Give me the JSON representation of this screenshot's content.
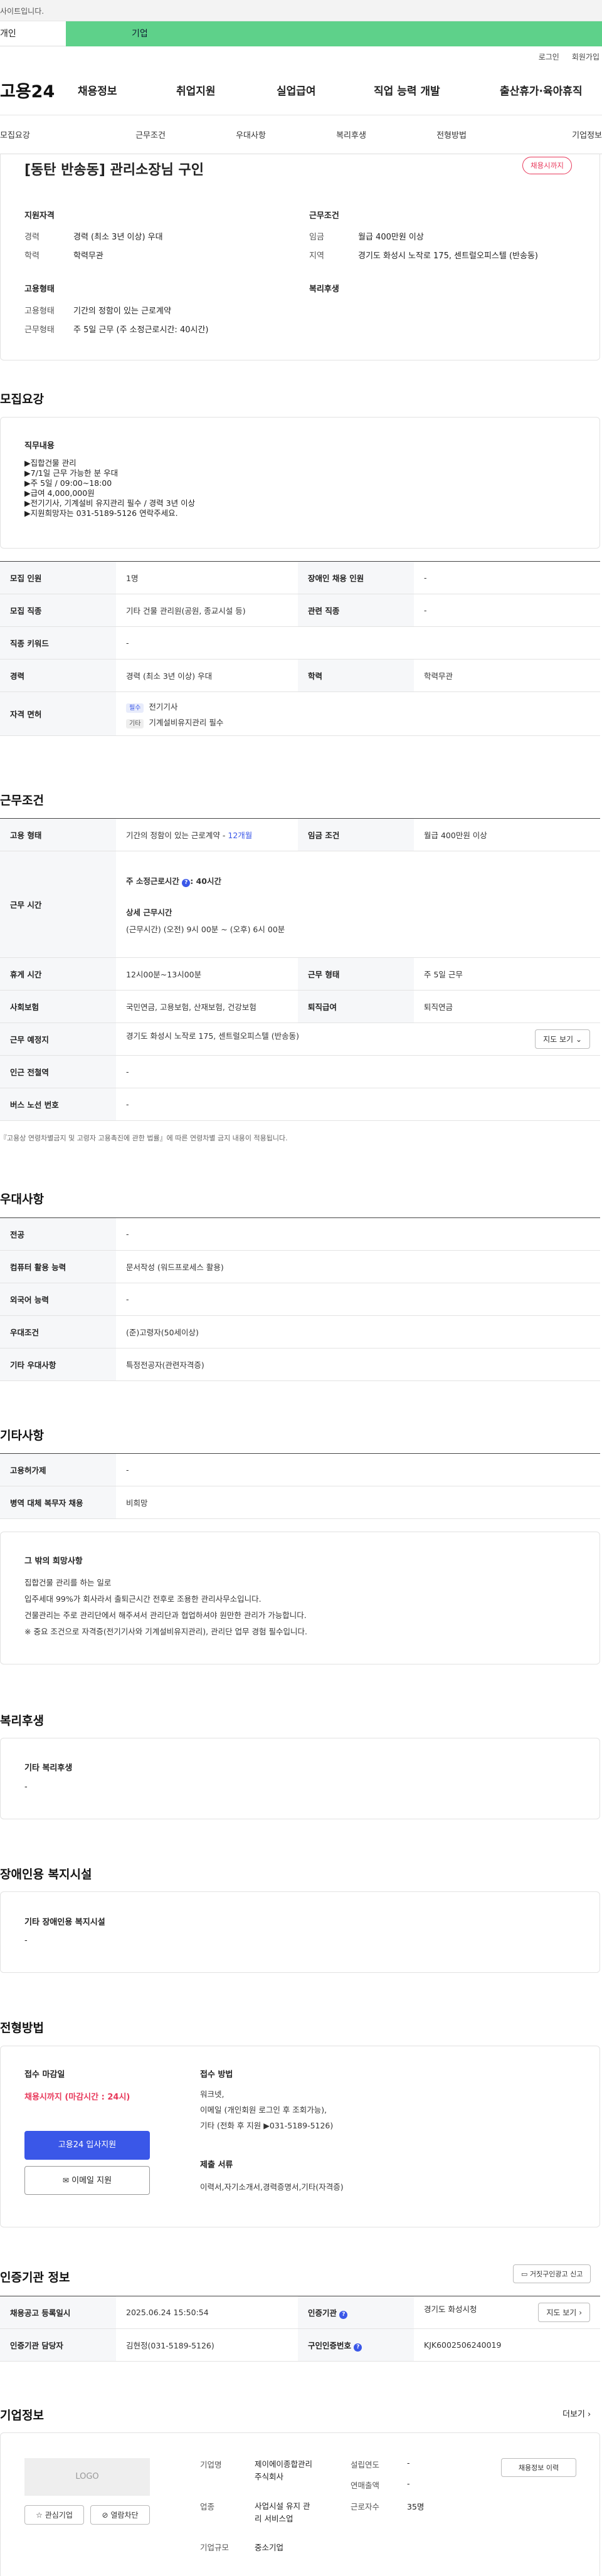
{
  "top_notice": "사이트입니다.",
  "user_tabs": {
    "personal": "개인",
    "corporate": "기업"
  },
  "util": {
    "login": "로그인",
    "signup": "회원가입"
  },
  "logo": "고용24",
  "gnb": [
    "채용정보",
    "취업지원",
    "실업급여",
    "직업 능력 개발",
    "출산휴가·육아휴직"
  ],
  "subnav": [
    "모집요강",
    "근무조건",
    "우대사항",
    "복리후생",
    "전형방법",
    "기업정보"
  ],
  "header": {
    "title": "[동탄 반송동] 관리소장님 구인",
    "badge": "채용시까지",
    "apply_label": "지원자격",
    "work_label": "근무조건",
    "career_k": "경력",
    "career_v": "경력 (최소 3년 이상) 우대",
    "edu_k": "학력",
    "edu_v": "학력무관",
    "wage_k": "임금",
    "wage_v": "월급 400만원 이상",
    "region_k": "지역",
    "region_v": "경기도 화성시 노작로 175, 센트럴오피스텔 (반송동)",
    "emp_label": "고용형태",
    "welfare_label": "복리후생",
    "emptype_k": "고용형태",
    "emptype_v": "기간의 정함이 있는 근로계약",
    "workform_k": "근무형태",
    "workform_v": "주 5일 근무 (주 소정근로시간: 40시간)"
  },
  "recruit": {
    "title": "모집요강",
    "duty_label": "직무내용",
    "duty_lines": [
      "▶집합건물 관리",
      "▶7/1일 근무 가능한 분 우대",
      "▶주 5일 / 09:00~18:00",
      "▶급여 4,000,000원",
      "▶전기기사, 기계설비 유지관리 필수 / 경력 3년 이상",
      "▶지원희망자는 031-5189-5126 연락주세요."
    ],
    "rows": {
      "count_k": "모집 인원",
      "count_v": "1명",
      "disabled_k": "장애인 채용 인원",
      "disabled_v": "-",
      "job_k": "모집 직종",
      "job_v": "기타 건물 관리원(공원, 종교시설 등)",
      "related_k": "관련 직종",
      "related_v": "-",
      "keyword_k": "직종 키워드",
      "keyword_v": "-",
      "career_k": "경력",
      "career_v": "경력 (최소 3년 이상) 우대",
      "edu_k": "학력",
      "edu_v": "학력무관",
      "license_k": "자격 면허",
      "license1_tag": "필수",
      "license1": "전기기사",
      "license2_tag": "기타",
      "license2": "기계설비유지관리 필수"
    }
  },
  "conditions": {
    "title": "근무조건",
    "emptype_k": "고용 형태",
    "emptype_v": "기간의 정함이 있는 근로계약 - ",
    "emptype_months": "12개월",
    "wage_k": "임금 조건",
    "wage_v": "월급 400만원 이상",
    "hours_k": "근무 시간",
    "hours_weekly": "주 소정근로시간 ",
    "hours_weekly_v": ": 40시간",
    "hours_detail_label": "상세 근무시간",
    "hours_detail": "(근무시간) (오전) 9시 00분 ~ (오후) 6시 00분",
    "break_k": "휴게 시간",
    "break_v": "12시00분~13시00분",
    "workform_k": "근무 형태",
    "workform_v": "주 5일 근무",
    "insurance_k": "사회보험",
    "insurance_v": "국민연금, 고용보험, 산재보험, 건강보험",
    "severance_k": "퇴직급여",
    "severance_v": "퇴직연금",
    "place_k": "근무 예정지",
    "place_v": "경기도 화성시 노작로 175, 센트럴오피스텔 (반송동)",
    "map_btn": "지도 보기",
    "subway_k": "인근 전철역",
    "subway_v": "-",
    "bus_k": "버스 노선 번호",
    "bus_v": "-",
    "note": "『고용상 연령차별금지 및 고령자 고용촉진에 관한 법률』에 따른 연령차별 금지 내용이 적용됩니다."
  },
  "preference": {
    "title": "우대사항",
    "major_k": "전공",
    "major_v": "-",
    "computer_k": "컴퓨터 활용 능력",
    "computer_v": "문서작성 (워드프로세스 활용)",
    "lang_k": "외국어 능력",
    "lang_v": "-",
    "cond_k": "우대조건",
    "cond_v": "(준)고령자(50세이상)",
    "etc_k": "기타 우대사항",
    "etc_v": "특정전공자(관련자격증)"
  },
  "other": {
    "title": "기타사항",
    "promo_k": "고용허가제",
    "promo_v": "-",
    "military_k": "병역 대체 복무자 채용",
    "military_v": "비희망",
    "wish_title": "그 밖의 희망사항",
    "wish_lines": [
      "집합건물 관리를 하는 일로",
      "입주세대 99%가 회사라서 출퇴근시간 전후로 조용한 관리사무소입니다.",
      "건물관리는 주로 관리단에서 해주셔서 관리단과 협업하셔야 원만한 관리가 가능합니다.",
      "※ 중요 조건으로 자격증(전기기사와 기계설비유지관리), 관리단 업무 경험 필수입니다."
    ]
  },
  "welfare": {
    "title": "복리후생",
    "box_title": "기타 복리후생",
    "box_value": "-"
  },
  "disabled": {
    "title": "장애인용 복지시설",
    "box_title": "기타 장애인용 복지시설",
    "box_value": "-"
  },
  "selection": {
    "title": "전형방법",
    "deadline_label": "접수 마감일",
    "deadline_value": "채용시까지 (마감시간 : 24시)",
    "apply_btn": "고용24 입사지원",
    "email_btn": "이메일 지원",
    "method_label": "접수 방법",
    "method_lines": [
      "워크넷,",
      "이메일 (개인회원 로그인 후 조회가능),",
      "기타 (전화 후 지원 ▶031-5189-5126)"
    ],
    "docs_label": "제출 서류",
    "docs_value": "이력서,자기소개서,경력증명서,기타(자격증)"
  },
  "auth": {
    "title": "인증기관 정보",
    "report_btn": "거짓구인광고 신고",
    "reg_k": "채용공고 등록일시",
    "reg_v": "2025.06.24 15:50:54",
    "org_k": "인증기관",
    "org_v": "경기도 화성시청",
    "map_btn": "지도 보기",
    "mgr_k": "인증기관 담당자",
    "mgr_v": "김현정(031-5189-5126)",
    "num_k": "구인인증번호",
    "num_v": "KJK6002506240019"
  },
  "company": {
    "title": "기업정보",
    "more": "더보기",
    "logo": "LOGO",
    "interest_btn": "관심기업",
    "block_btn": "열람차단",
    "name_k": "기업명",
    "name_v1": "제이에이종합관리",
    "name_v2": "주식회사",
    "biz_k": "업종",
    "biz_v1": "사업시설 유지 관",
    "biz_v2": "리 서비스업",
    "size_k": "기업규모",
    "size_v": "중소기업",
    "found_k": "설립연도",
    "found_v": "-",
    "sales_k": "연매출액",
    "sales_v": "-",
    "staff_k": "근로자수",
    "staff_v": "35명",
    "recruit_btn": "채용정보 이력"
  },
  "colors": {
    "accent": "#3a57e8",
    "danger": "#e8395b",
    "green": "#5ed18a"
  }
}
